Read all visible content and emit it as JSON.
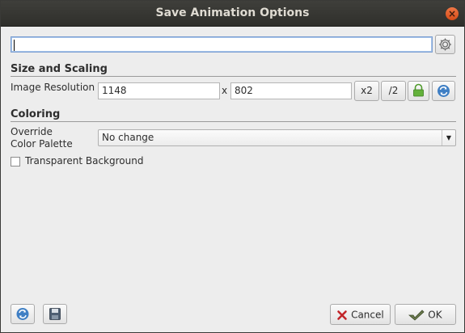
{
  "window": {
    "title": "Save Animation Options"
  },
  "path_input": {
    "value": ""
  },
  "size_section": {
    "title": "Size and Scaling",
    "resolution_label": "Image Resolution",
    "width": "1148",
    "separator": "x",
    "height": "802",
    "double_label": "x2",
    "half_label": "/2"
  },
  "coloring_section": {
    "title": "Coloring",
    "override_label_line1": "Override",
    "override_label_line2": "Color Palette",
    "palette_selected": "No change",
    "transparent_label": "Transparent Background",
    "transparent_checked": false
  },
  "footer": {
    "cancel_label": "Cancel",
    "ok_label": "OK"
  },
  "icons": [
    "close-icon",
    "gear-icon",
    "lock-icon",
    "refresh-icon",
    "save-icon",
    "cancel-x-icon",
    "ok-check-icon",
    "chevron-down-icon"
  ],
  "colors": {
    "titlebar": "#33332f",
    "close": "#e95420",
    "field_focus": "#7c9fd1"
  }
}
